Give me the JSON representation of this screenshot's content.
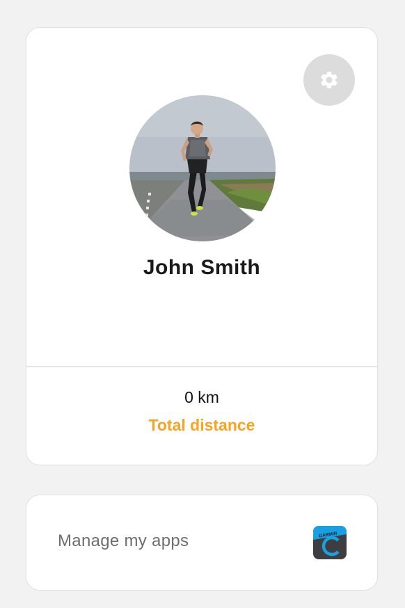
{
  "profile": {
    "name": "John Smith",
    "avatar_icon": "runner-photo"
  },
  "stats": {
    "total_distance_value": "0 km",
    "total_distance_label": "Total distance"
  },
  "settings": {
    "icon": "gear-icon"
  },
  "apps": {
    "label": "Manage my apps",
    "app_icon_text": "GARMIN"
  },
  "colors": {
    "accent": "#f7a325",
    "background": "#f2f2f2",
    "garmin_blue": "#1aa0e0"
  }
}
